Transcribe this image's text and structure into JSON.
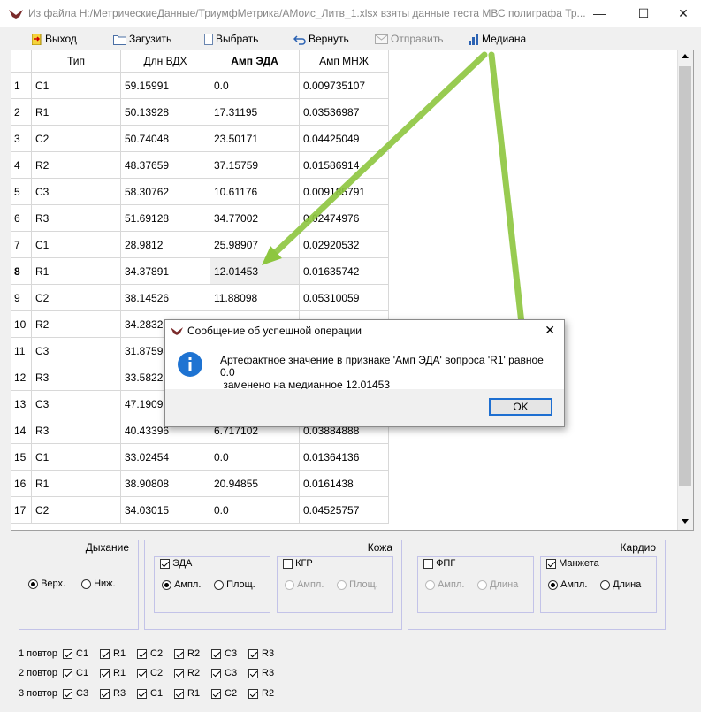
{
  "window": {
    "title": "Из файла H:/МетрическиеДанные/ТриумфМетрика/АМоис_Литв_1.xlsx взяты данные теста МВС полиграфа Тр...",
    "minimize": "—",
    "maximize": "☐",
    "close": "✕"
  },
  "toolbar": {
    "items": [
      {
        "label": "Выход",
        "icon": "exit-icon"
      },
      {
        "label": "Загузить",
        "icon": "folder-icon"
      },
      {
        "label": "Выбрать",
        "icon": "document-icon"
      },
      {
        "label": "Вернуть",
        "icon": "undo-icon"
      },
      {
        "label": "Отправить",
        "icon": "mail-icon"
      },
      {
        "label": "Медиана",
        "icon": "bar-chart-icon"
      }
    ]
  },
  "table": {
    "columns": [
      "Тип",
      "Длн ВДХ",
      "Амп ЭДА",
      "Амп МНЖ"
    ],
    "rows": [
      {
        "n": "1",
        "cells": [
          "C1",
          "59.15991",
          "0.0",
          "0.009735107"
        ]
      },
      {
        "n": "2",
        "cells": [
          "R1",
          "50.13928",
          "17.31195",
          "0.03536987"
        ]
      },
      {
        "n": "3",
        "cells": [
          "C2",
          "50.74048",
          "23.50171",
          "0.04425049"
        ]
      },
      {
        "n": "4",
        "cells": [
          "R2",
          "48.37659",
          "37.15759",
          "0.01586914"
        ]
      },
      {
        "n": "5",
        "cells": [
          "C3",
          "58.30762",
          "10.61176",
          "0.009185791"
        ]
      },
      {
        "n": "6",
        "cells": [
          "R3",
          "51.69128",
          "34.77002",
          "0.02474976"
        ]
      },
      {
        "n": "7",
        "cells": [
          "C1",
          "28.9812",
          "25.98907",
          "0.02920532"
        ]
      },
      {
        "n": "8",
        "cells": [
          "R1",
          "34.37891",
          "12.01453",
          "0.01635742"
        ]
      },
      {
        "n": "9",
        "cells": [
          "C2",
          "38.14526",
          "11.88098",
          "0.05310059"
        ]
      },
      {
        "n": "10",
        "cells": [
          "R2",
          "34.2832",
          "",
          ""
        ]
      },
      {
        "n": "11",
        "cells": [
          "C3",
          "31.87598",
          "",
          ""
        ]
      },
      {
        "n": "12",
        "cells": [
          "R3",
          "33.58228",
          "",
          ""
        ]
      },
      {
        "n": "13",
        "cells": [
          "C3",
          "47.19092",
          "",
          ""
        ]
      },
      {
        "n": "14",
        "cells": [
          "R3",
          "40.43396",
          "6.717102",
          "0.03884888"
        ]
      },
      {
        "n": "15",
        "cells": [
          "C1",
          "33.02454",
          "0.0",
          "0.01364136"
        ]
      },
      {
        "n": "16",
        "cells": [
          "R1",
          "38.90808",
          "20.94855",
          "0.0161438"
        ]
      },
      {
        "n": "17",
        "cells": [
          "C2",
          "34.03015",
          "0.0",
          "0.04525757"
        ]
      }
    ]
  },
  "groups": {
    "breath": {
      "title": "Дыхание",
      "opt1": "Верх.",
      "opt2": "Ниж."
    },
    "skin": {
      "title": "Кожа",
      "eda": "ЭДА",
      "kgr": "КГР",
      "ampl": "Ампл.",
      "area": "Площ."
    },
    "cardio": {
      "title": "Кардио",
      "fpg": "ФПГ",
      "cuff": "Манжета",
      "ampl": "Ампл.",
      "length": "Длина"
    }
  },
  "repeats": [
    {
      "label": "1 повтор",
      "items": [
        "C1",
        "R1",
        "C2",
        "R2",
        "C3",
        "R3"
      ]
    },
    {
      "label": "2 повтор",
      "items": [
        "C1",
        "R1",
        "C2",
        "R2",
        "C3",
        "R3"
      ]
    },
    {
      "label": "3 повтор",
      "items": [
        "C3",
        "R3",
        "C1",
        "R1",
        "C2",
        "R2"
      ]
    }
  ],
  "dialog": {
    "title": "Сообщение об успешной операции",
    "line1": "Артефактное значение в признаке 'Амп ЭДА' вопроса 'R1' равное 0.0",
    "line2": " заменено на медианное 12.01453",
    "ok": "OK",
    "close": "✕"
  },
  "colors": {
    "arrow": "#8dc63f",
    "info": "#1e73d2",
    "focus": "#1e6fd1"
  }
}
